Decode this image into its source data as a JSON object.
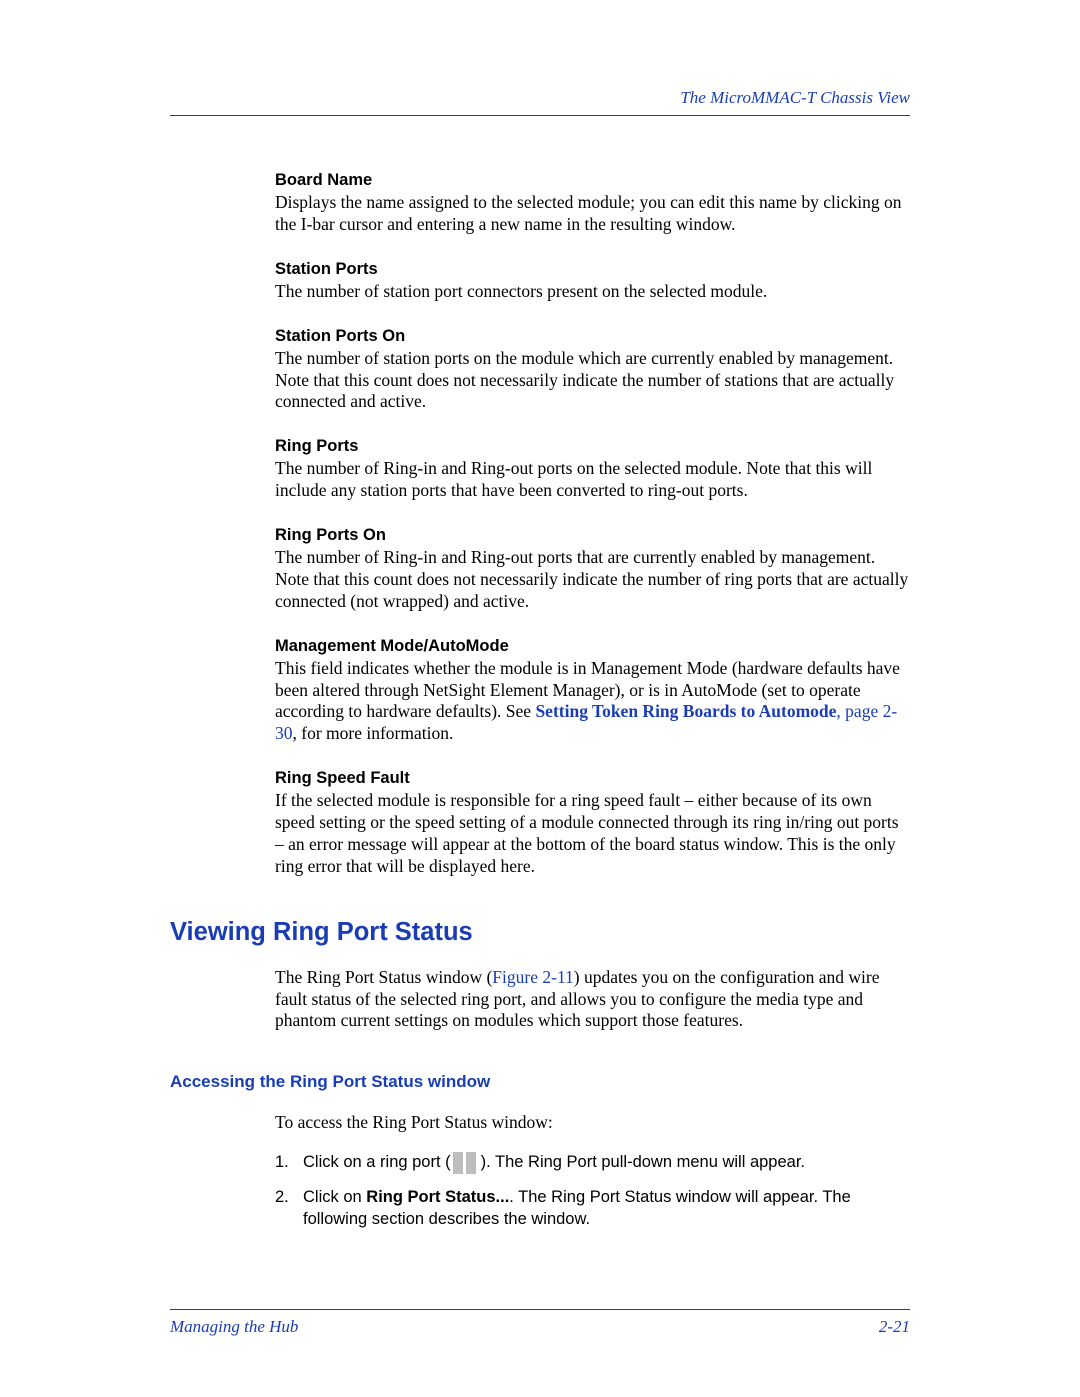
{
  "header": {
    "title": "The MicroMMAC-T Chassis View"
  },
  "defs": [
    {
      "term": "Board Name",
      "body": "Displays the name assigned to the selected module; you can edit this name by clicking on the I-bar cursor and entering a new name in the resulting window."
    },
    {
      "term": "Station Ports",
      "body": "The number of station port connectors present on the selected module."
    },
    {
      "term": "Station Ports On",
      "body": "The number of station ports on the module which are currently enabled by management. Note that this count does not necessarily indicate the number of stations that are actually connected and active."
    },
    {
      "term": "Ring Ports",
      "body": "The number of Ring-in and Ring-out ports on the selected module. Note that this will include any station ports that have been converted to ring-out ports."
    },
    {
      "term": "Ring Ports On",
      "body": "The number of Ring-in and Ring-out ports that are currently enabled by management. Note that this count does not necessarily indicate the number of ring ports that are actually connected (not wrapped) and active."
    },
    {
      "term": "Management Mode/AutoMode",
      "pre": "This field indicates whether the module is in Management Mode (hardware defaults have been altered through NetSight Element Manager), or is in AutoMode (set to operate according to hardware defaults). See ",
      "link": "Setting Token Ring Boards to Automode",
      "page": ", page 2-30",
      "post": ", for more information."
    },
    {
      "term": "Ring Speed Fault",
      "body": "If the selected module is responsible for a ring speed fault – either because of its own speed setting or the speed setting of a module connected through its ring in/ring out ports – an error message will appear at the bottom of the board status window. This is the only ring error that will be displayed here."
    }
  ],
  "section": {
    "heading": "Viewing Ring Port Status",
    "intro_pre": "The Ring Port Status window (",
    "figref": "Figure 2-11",
    "intro_post": ") updates you on the configuration and wire fault status of the selected ring port, and allows you to configure the media type and phantom current settings on modules which support those features."
  },
  "sub": {
    "heading": "Accessing the Ring Port Status window",
    "access_line": "To access the Ring Port Status window:"
  },
  "steps": [
    {
      "num": "1.",
      "pre": "Click on a ring port (",
      "post": "). The Ring Port pull-down menu will appear."
    },
    {
      "num": "2.",
      "pre": "Click on ",
      "bold": "Ring Port Status...",
      "post": ". The Ring Port Status window will appear. The following section describes the window."
    }
  ],
  "footer": {
    "left": "Managing the Hub",
    "right": "2-21"
  }
}
